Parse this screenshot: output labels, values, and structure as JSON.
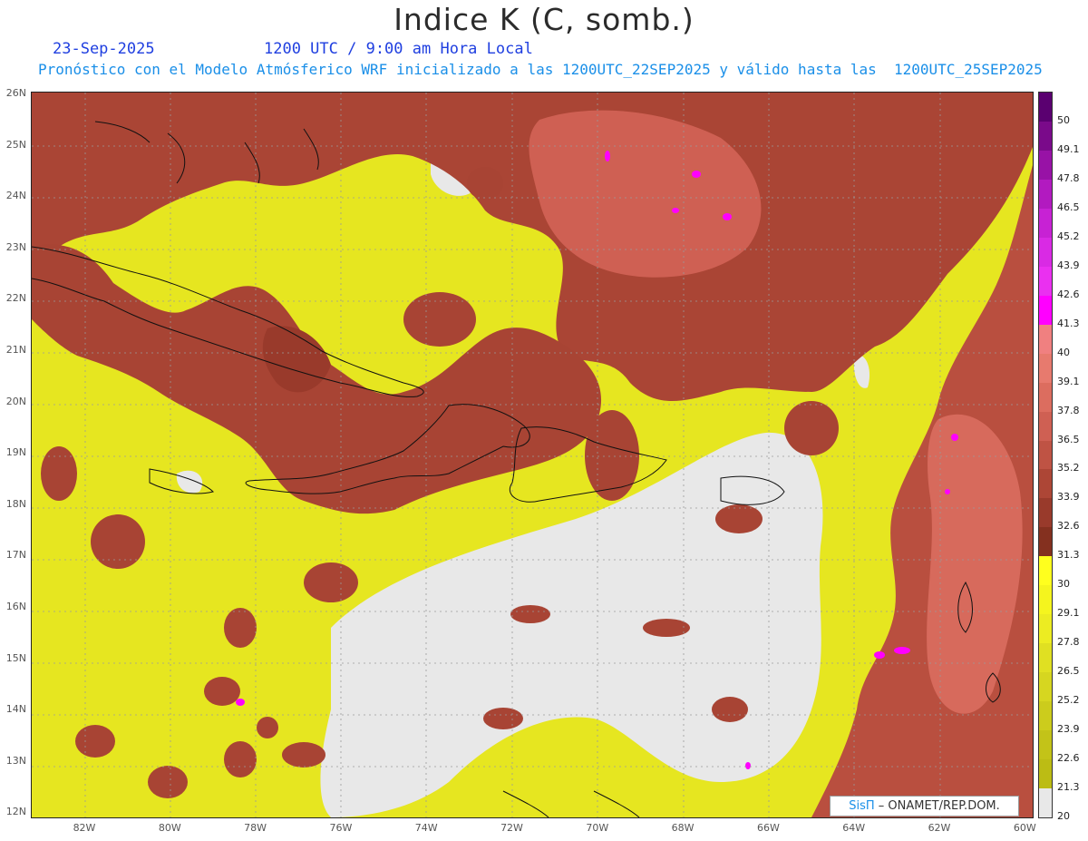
{
  "title": "Indice K (C, somb.)",
  "date": "23-Sep-2025",
  "time": "1200 UTC / 9:00 am Hora Local",
  "subtitle": "Pronóstico con el Modelo Atmósferico WRF inicializado a las 1200UTC_22SEP2025 y válido hasta las  1200UTC_25SEP2025",
  "lat_labels": [
    "26N",
    "25N",
    "24N",
    "23N",
    "22N",
    "21N",
    "20N",
    "19N",
    "18N",
    "17N",
    "16N",
    "15N",
    "14N",
    "13N",
    "12N"
  ],
  "lon_labels": [
    "82W",
    "80W",
    "78W",
    "76W",
    "74W",
    "72W",
    "70W",
    "68W",
    "66W",
    "64W",
    "62W",
    "60W"
  ],
  "colorbar": {
    "labels": [
      "50",
      "49.1",
      "47.8",
      "46.5",
      "45.2",
      "43.9",
      "42.6",
      "41.3",
      "40",
      "39.1",
      "37.8",
      "36.5",
      "35.2",
      "33.9",
      "32.6",
      "31.3",
      "30",
      "29.1",
      "27.8",
      "26.5",
      "25.2",
      "23.9",
      "22.6",
      "21.3",
      "20"
    ],
    "colors": [
      "#5a0070",
      "#7a0a8a",
      "#9812a6",
      "#b21ac0",
      "#c722d4",
      "#d92ae4",
      "#ea30f0",
      "#ff00ff",
      "#f08080",
      "#e77a6e",
      "#dc6d5f",
      "#cf6053",
      "#bf5344",
      "#ad4636",
      "#993a2b",
      "#84301f",
      "#ffff1e",
      "#f5f51e",
      "#ecec22",
      "#e0e022",
      "#d6d620",
      "#cccc1c",
      "#c3c318",
      "#bcbc14",
      "#e8e8e8"
    ]
  },
  "credit": {
    "brand": "SisΠ",
    "text": "– ONAMET/REP.DOM."
  }
}
